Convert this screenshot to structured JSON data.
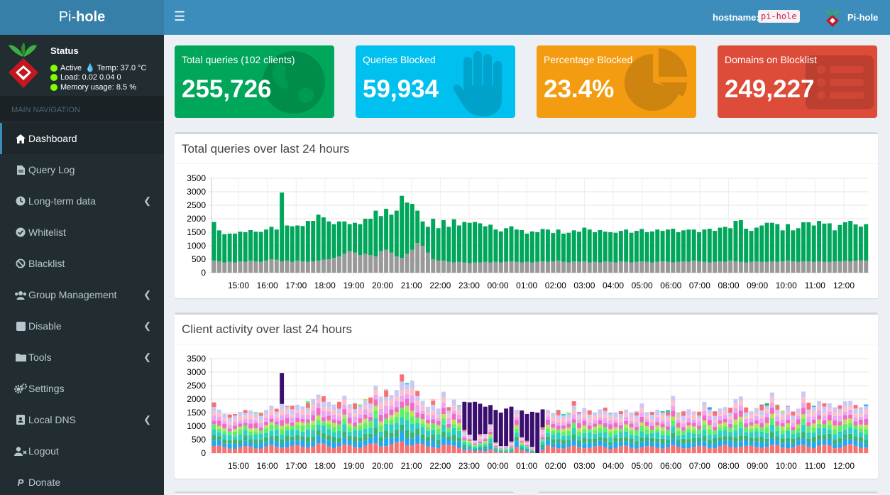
{
  "brand": {
    "prefix": "Pi-",
    "bold": "hole"
  },
  "status": {
    "title": "Status",
    "active": "Active",
    "temp": "Temp: 37.0 °C",
    "load": "Load:  0.02  0.04  0",
    "memory": "Memory usage:  8.5 %"
  },
  "nav_header": "MAIN NAVIGATION",
  "menu": [
    {
      "label": "Dashboard",
      "icon": "home-icon",
      "active": true
    },
    {
      "label": "Query Log",
      "icon": "file-icon"
    },
    {
      "label": "Long-term data",
      "icon": "clock-icon",
      "has_children": true
    },
    {
      "label": "Whitelist",
      "icon": "check-circle-icon"
    },
    {
      "label": "Blacklist",
      "icon": "ban-icon"
    },
    {
      "label": "Group Management",
      "icon": "users-icon",
      "has_children": true
    },
    {
      "label": "Disable",
      "icon": "stop-icon",
      "has_children": true
    },
    {
      "label": "Tools",
      "icon": "folder-icon",
      "has_children": true
    },
    {
      "label": "Settings",
      "icon": "gears-icon"
    },
    {
      "label": "Local DNS",
      "icon": "address-book-icon",
      "has_children": true
    },
    {
      "label": "Logout",
      "icon": "user-times-icon"
    },
    {
      "label": "Donate",
      "icon": "paypal-icon"
    }
  ],
  "header": {
    "hostname_label": "hostname:",
    "hostname": "pi-hole",
    "user": "Pi-hole"
  },
  "stats": [
    {
      "label": "Total queries (102 clients)",
      "value": "255,726",
      "color": "#00a65a",
      "icon": "globe-icon"
    },
    {
      "label": "Queries Blocked",
      "value": "59,934",
      "color": "#00c0ef",
      "icon": "hand-icon"
    },
    {
      "label": "Percentage Blocked",
      "value": "23.4%",
      "color": "#f39c12",
      "icon": "pie-chart-icon"
    },
    {
      "label": "Domains on Blocklist",
      "value": "249,227",
      "color": "#dd4b39",
      "icon": "list-icon"
    }
  ],
  "panels": {
    "queries_title": "Total queries over last 24 hours",
    "clients_title": "Client activity over last 24 hours"
  },
  "chart_data": [
    {
      "type": "bar",
      "stacked": true,
      "title": "Total queries over last 24 hours",
      "ylim": [
        0,
        3500
      ],
      "yticks": [
        "0",
        "500",
        "1000",
        "1500",
        "2000",
        "2500",
        "3000",
        "3500"
      ],
      "xticks": [
        "15:00",
        "16:00",
        "17:00",
        "18:00",
        "19:00",
        "20:00",
        "21:00",
        "22:00",
        "23:00",
        "00:00",
        "01:00",
        "02:00",
        "03:00",
        "04:00",
        "05:00",
        "06:00",
        "07:00",
        "08:00",
        "09:00",
        "10:00",
        "11:00",
        "12:00"
      ],
      "grid": true,
      "series": [
        {
          "color": "#999999",
          "values": [
            450,
            420,
            380,
            400,
            380,
            420,
            400,
            450,
            420,
            400,
            450,
            500,
            480,
            420,
            450,
            400,
            450,
            420,
            400,
            420,
            450,
            480,
            500,
            550,
            600,
            700,
            800,
            750,
            650,
            700,
            650,
            600,
            800,
            850,
            750,
            600,
            550,
            700,
            850,
            1100,
            1000,
            750,
            500,
            450,
            450,
            400,
            380,
            400,
            380,
            350,
            380,
            380,
            400,
            380,
            400,
            380,
            400,
            420,
            400,
            380,
            400,
            380,
            400,
            420,
            400,
            420,
            450,
            400,
            380,
            420,
            400,
            420,
            380,
            400,
            380,
            420,
            400,
            380,
            420,
            400,
            380,
            400,
            420,
            400,
            380,
            400,
            420,
            400,
            380,
            400,
            420,
            400,
            450,
            420,
            400,
            380,
            400,
            420,
            400,
            450,
            420,
            400,
            380,
            400,
            420,
            400,
            400,
            420,
            400,
            420,
            450,
            420,
            400,
            420,
            420,
            400,
            420,
            400,
            400,
            420,
            420,
            440,
            420,
            440,
            460,
            450
          ]
        },
        {
          "color": "#00a65a",
          "values": [
            1430,
            1150,
            1050,
            1050,
            1070,
            1100,
            1100,
            1130,
            1100,
            1110,
            1150,
            1200,
            1120,
            2550,
            1300,
            1320,
            1300,
            1310,
            1520,
            1500,
            1700,
            1570,
            1400,
            1250,
            1300,
            1200,
            1000,
            1100,
            1150,
            1300,
            1350,
            1700,
            1300,
            1520,
            1400,
            1700,
            2300,
            1900,
            1700,
            1200,
            900,
            950,
            1500,
            1200,
            1500,
            1300,
            1600,
            1350,
            1500,
            1500,
            1500,
            1450,
            1320,
            1400,
            1200,
            1150,
            1250,
            1300,
            1200,
            1200,
            1050,
            1150,
            1100,
            1200,
            1200,
            1050,
            1150,
            1050,
            1100,
            1150,
            1120,
            1250,
            1220,
            1100,
            1200,
            1100,
            1100,
            1100,
            1130,
            1200,
            1100,
            1150,
            1200,
            1100,
            1150,
            1200,
            1130,
            1200,
            1250,
            1100,
            1150,
            1200,
            1150,
            1080,
            1200,
            1250,
            1150,
            1250,
            1300,
            1200,
            1500,
            1550,
            1250,
            1150,
            1250,
            1350,
            1450,
            1430,
            1400,
            1150,
            1350,
            1150,
            1250,
            1450,
            1450,
            1350,
            1500,
            1420,
            1430,
            1150,
            1350,
            1430,
            1500,
            1350,
            1250,
            1350
          ]
        }
      ]
    },
    {
      "type": "bar",
      "stacked": true,
      "title": "Client activity over last 24 hours",
      "ylim": [
        0,
        3500
      ],
      "yticks": [
        "0",
        "500",
        "1000",
        "1500",
        "2000",
        "2500",
        "3000",
        "3500"
      ],
      "xticks": [
        "15:00",
        "16:00",
        "17:00",
        "18:00",
        "19:00",
        "20:00",
        "21:00",
        "22:00",
        "23:00",
        "00:00",
        "01:00",
        "02:00",
        "03:00",
        "04:00",
        "05:00",
        "06:00",
        "07:00",
        "08:00",
        "09:00",
        "10:00",
        "11:00",
        "12:00"
      ],
      "grid": true,
      "series_colors": [
        "#f87171",
        "#22a7f0",
        "#3bb371",
        "#2fd0c4",
        "#5cf06a",
        "#b5e35c",
        "#f06cc4",
        "#e9a6f5",
        "#ffc0cb",
        "#c9c9f5",
        "#3b0f70"
      ],
      "totals": [
        1880,
        1570,
        1430,
        1450,
        1450,
        1520,
        1500,
        1580,
        1520,
        1510,
        1600,
        1700,
        1600,
        2970,
        1750,
        1720,
        1750,
        1730,
        1920,
        1920,
        2150,
        2050,
        1900,
        1800,
        1900,
        1900,
        1800,
        1850,
        1800,
        2000,
        2000,
        2300,
        2100,
        2370,
        2150,
        2300,
        2850,
        2600,
        2550,
        2300,
        1900,
        1700,
        2000,
        1650,
        1950,
        1700,
        1980,
        1770,
        1900,
        1880,
        1900,
        1830,
        1720,
        1780,
        1600,
        1500,
        1650,
        1720,
        1600,
        1580,
        1450,
        1530,
        1500,
        1620,
        1600,
        1470,
        1600,
        1450,
        1480,
        1570,
        1520,
        1670,
        1600,
        1500,
        1580,
        1520,
        1480,
        1500,
        1550,
        1600,
        1480,
        1550,
        1620,
        1500,
        1530,
        1600,
        1550,
        1600,
        1700,
        1500,
        1550,
        1620,
        1550,
        1530,
        1600,
        1700,
        1550,
        1650,
        1700,
        1650,
        1950,
        1970,
        1650,
        1550,
        1670,
        1800,
        1850,
        1850,
        1800,
        1570,
        1750,
        1550,
        1650,
        1870,
        1870,
        1750,
        1920,
        1840,
        1830,
        1570,
        1770,
        1870,
        1920,
        1790,
        1690,
        1800
      ],
      "dark_top": [
        0,
        0,
        0,
        0,
        0,
        0,
        0,
        0,
        0,
        0,
        0,
        0,
        0,
        1100,
        0,
        0,
        0,
        0,
        0,
        0,
        0,
        0,
        0,
        0,
        0,
        0,
        0,
        0,
        0,
        0,
        0,
        0,
        0,
        0,
        0,
        0,
        0,
        0,
        0,
        0,
        0,
        0,
        0,
        0,
        0,
        0,
        0,
        0,
        1000,
        1200,
        1500,
        1100,
        1000,
        700,
        1200,
        1250,
        1400,
        1300,
        0,
        1000,
        1000,
        1300,
        1500,
        800,
        0,
        0,
        0,
        0,
        0,
        0,
        0,
        0,
        0,
        0,
        0,
        0,
        0,
        0,
        0,
        0,
        0,
        0,
        0,
        0,
        0,
        0,
        0,
        0,
        0,
        0,
        0,
        0,
        0,
        0,
        0,
        0,
        0,
        0,
        0,
        0,
        0,
        0,
        0,
        0,
        0,
        0,
        0,
        0,
        0,
        0,
        0,
        0,
        0,
        0,
        0,
        0,
        0,
        0,
        0,
        0,
        0,
        0,
        0,
        0,
        0,
        0,
        0
      ]
    }
  ]
}
